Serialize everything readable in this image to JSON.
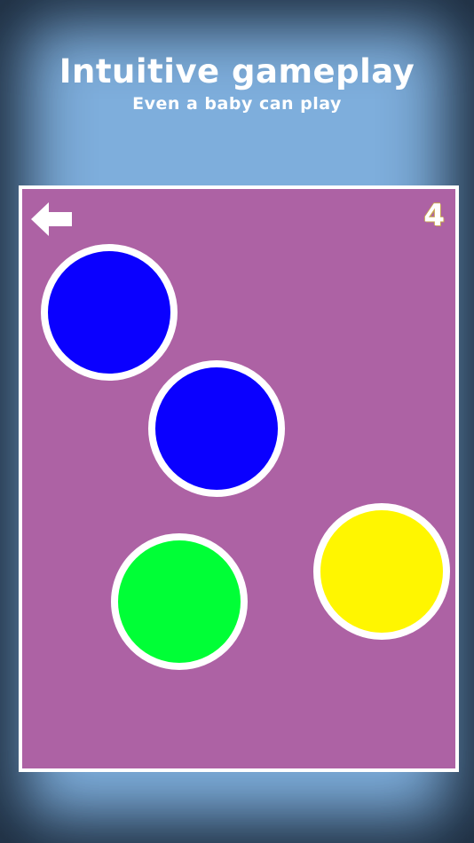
{
  "header": {
    "title": "Intuitive gameplay",
    "subtitle": "Even a baby can play"
  },
  "game": {
    "score": "4",
    "back_icon": "arrow-left-icon",
    "background_color": "#ad62a4",
    "balls": [
      {
        "color_name": "blue",
        "color": "#0a00ff"
      },
      {
        "color_name": "blue",
        "color": "#0a00ff"
      },
      {
        "color_name": "yellow",
        "color": "#fff600"
      },
      {
        "color_name": "green",
        "color": "#00ff36"
      }
    ]
  },
  "colors": {
    "page_background": "#7eaedc",
    "text": "#ffffff",
    "ball_border": "#ffffff"
  }
}
